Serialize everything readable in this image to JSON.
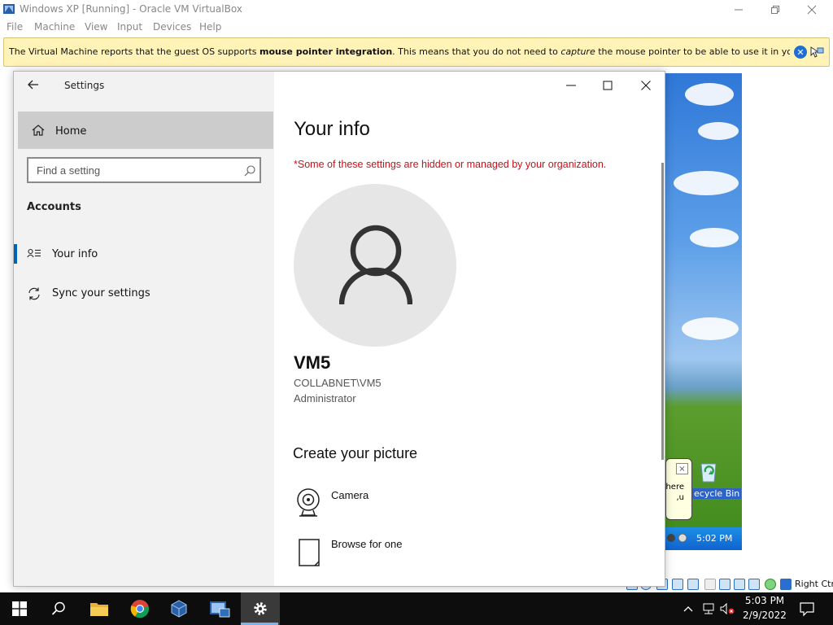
{
  "vbox": {
    "title": "Windows XP [Running] - Oracle VM VirtualBox",
    "menu": [
      "File",
      "Machine",
      "View",
      "Input",
      "Devices",
      "Help"
    ],
    "notification": {
      "prefix": "The Virtual Machine reports that the guest OS supports ",
      "bold": "mouse pointer integration",
      "middle": ". This means that you do not need to ",
      "italic": "capture",
      "suffix": " the mouse pointer to be able to use it in your guest OS -- all mouse"
    },
    "host_key": "Right Ctrl"
  },
  "guest": {
    "balloon_text_line1": "here.",
    "balloon_text_line2": "u,",
    "recycle_bin_label": "ecycle Bin",
    "clock": "5:02 PM",
    "balloon_close": "×"
  },
  "settings": {
    "window_title": "Settings",
    "home_label": "Home",
    "search_placeholder": "Find a setting",
    "section_heading": "Accounts",
    "nav_items": [
      {
        "label": "Your info",
        "icon": "contact-card-icon",
        "selected": true
      },
      {
        "label": "Sync your settings",
        "icon": "sync-icon",
        "selected": false
      }
    ],
    "page_title": "Your info",
    "org_warning": "*Some of these settings are hidden or managed by your organization.",
    "user": {
      "name": "VM5",
      "account": "COLLABNET\\VM5",
      "role": "Administrator"
    },
    "create_picture_heading": "Create your picture",
    "picture_options": [
      {
        "label": "Camera",
        "icon": "camera-icon"
      },
      {
        "label": "Browse for one",
        "icon": "file-icon"
      }
    ]
  },
  "taskbar": {
    "time": "5:03 PM",
    "date": "2/9/2022"
  },
  "colors": {
    "accent": "#0063b1",
    "warning": "#c4121a",
    "notify_bg": "#fff3b8",
    "taskbar_bg": "#0d0d0d"
  }
}
